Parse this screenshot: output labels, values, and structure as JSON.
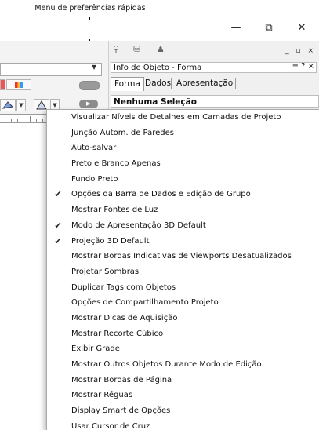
{
  "callout": {
    "text": "Menu de preferências rápidas"
  },
  "window": {
    "minimize": "—",
    "restore": "⧉",
    "close": "✕"
  },
  "toolbar": {
    "dropdown_arrow": "▼"
  },
  "panel": {
    "title": "Info de Objeto - Forma",
    "controls": "≡ ? ×",
    "tabs": [
      "Forma",
      "Dados",
      "Apresentação"
    ],
    "active_tab": 0,
    "selection": "Nenhuma Seleção",
    "tool_icons": [
      "magnifier-icon",
      "lock-icon",
      "user-lock-icon"
    ],
    "close_controls": "_ ▫ ×"
  },
  "menu": {
    "items": [
      {
        "label": "Visualizar Níveis de Detalhes em Camadas de Projeto",
        "checked": false
      },
      {
        "label": "Junção Autom. de Paredes",
        "checked": false
      },
      {
        "label": "Auto-salvar",
        "checked": false
      },
      {
        "label": "Preto e Branco Apenas",
        "checked": false
      },
      {
        "label": "Fundo Preto",
        "checked": false
      },
      {
        "label": "Opções da Barra de Dados e Edição de Grupo",
        "checked": true
      },
      {
        "label": "Mostrar Fontes de Luz",
        "checked": false
      },
      {
        "label": "Modo de Apresentação 3D Default",
        "checked": true
      },
      {
        "label": "Projeção 3D Default",
        "checked": true
      },
      {
        "label": "Mostrar Bordas Indicativas de Viewports Desatualizados",
        "checked": false
      },
      {
        "label": "Projetar Sombras",
        "checked": false
      },
      {
        "label": "Duplicar Tags com Objetos",
        "checked": false
      },
      {
        "label": "Opções de Compartilhamento Projeto",
        "checked": false
      },
      {
        "label": "Mostrar Dicas de Aquisição",
        "checked": false
      },
      {
        "label": "Mostrar Recorte Cúbico",
        "checked": false
      },
      {
        "label": "Exibir Grade",
        "checked": false
      },
      {
        "label": "Mostrar Outros Objetos Durante Modo de Edição",
        "checked": false
      },
      {
        "label": "Mostrar Bordas de Página",
        "checked": false
      },
      {
        "label": "Mostrar Réguas",
        "checked": false
      },
      {
        "label": "Display Smart de Opções",
        "checked": false
      },
      {
        "label": "Usar Cursor de Cruz",
        "checked": false
      }
    ],
    "check_glyph": "✔"
  },
  "colors": {
    "panel_bg": "#f0f0f0",
    "menu_bg": "#ffffff",
    "accent_button": "#8c8c8c"
  }
}
